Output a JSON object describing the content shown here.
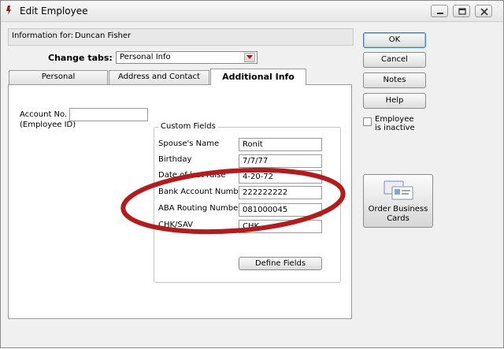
{
  "window": {
    "title": "Edit Employee"
  },
  "info": {
    "label": "Information for:",
    "name": "Duncan Fisher"
  },
  "change_tabs": {
    "label": "Change tabs:",
    "selected": "Personal Info"
  },
  "tabs": [
    {
      "label": "Personal",
      "active": false
    },
    {
      "label": "Address and Contact",
      "active": false
    },
    {
      "label": "Additional Info",
      "active": true
    }
  ],
  "account": {
    "label_line1": "Account No.",
    "label_line2": "(Employee ID)",
    "value": ""
  },
  "custom_fields": {
    "title": "Custom Fields",
    "fields": [
      {
        "label": "Spouse's Name",
        "value": "Ronit"
      },
      {
        "label": "Birthday",
        "value": "7/7/77"
      },
      {
        "label": "Date of last raise",
        "value": "4-20-72"
      },
      {
        "label": "Bank Account Number",
        "value": "222222222"
      },
      {
        "label": "ABA Routing Number",
        "value": "081000045"
      },
      {
        "label": "CHK/SAV",
        "value": "CHK"
      }
    ],
    "define_button": "Define Fields"
  },
  "side_buttons": {
    "ok": "OK",
    "cancel": "Cancel",
    "notes": "Notes",
    "help": "Help"
  },
  "inactive": {
    "label": "Employee is inactive",
    "checked": false
  },
  "cards_button": {
    "line1": "Order Business",
    "line2": "Cards"
  },
  "colors": {
    "highlight_oval": "#b31c1c",
    "ok_focus": "#3a7bd5"
  }
}
